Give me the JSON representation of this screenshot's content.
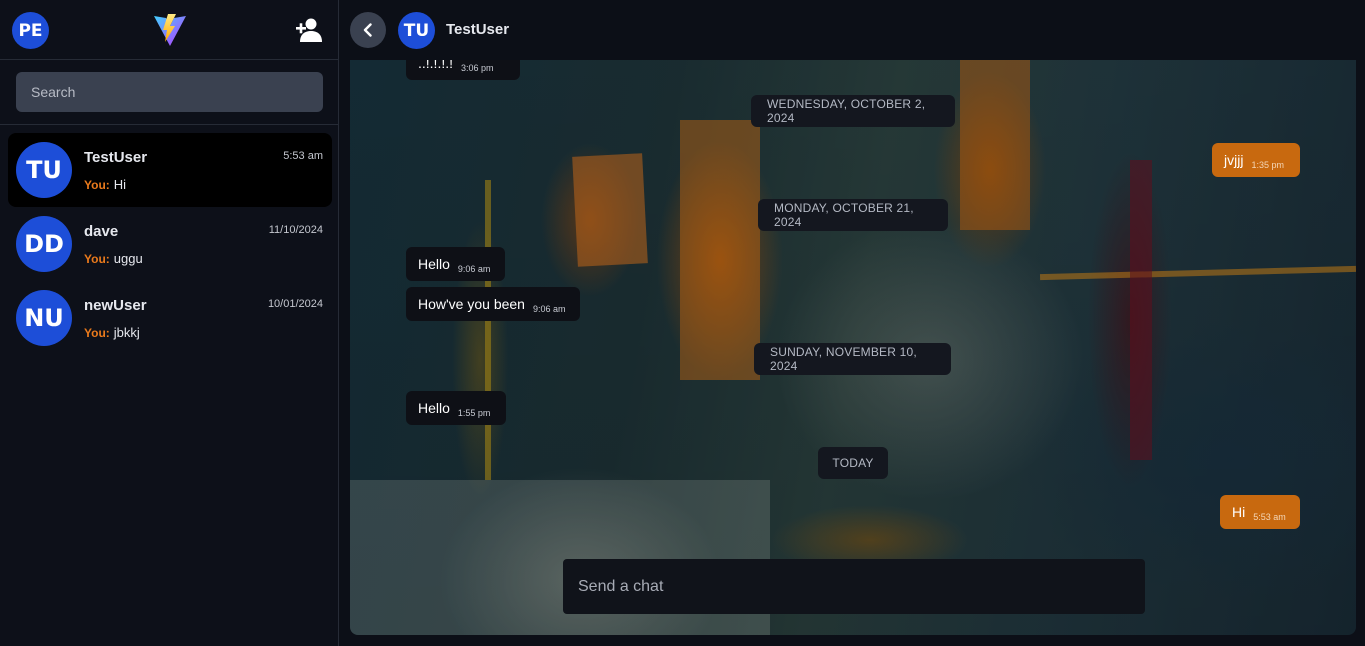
{
  "sidebar": {
    "user_initials": "PE",
    "search": {
      "placeholder": "Search",
      "value": ""
    },
    "conversations": [
      {
        "initials": "TU",
        "name": "TestUser",
        "time": "5:53 am",
        "you_label": "You:",
        "preview": "Hi",
        "active": true
      },
      {
        "initials": "DD",
        "name": "dave",
        "time": "11/10/2024",
        "you_label": "You:",
        "preview": "uggu",
        "active": false
      },
      {
        "initials": "NU",
        "name": "newUser",
        "time": "10/01/2024",
        "you_label": "You:",
        "preview": "jbkkj",
        "active": false
      }
    ]
  },
  "chat": {
    "header": {
      "initials": "TU",
      "name": "TestUser"
    },
    "partial_message": {
      "text": "..!.!.!.!",
      "time": "3:06 pm"
    },
    "dividers": [
      "WEDNESDAY, OCTOBER 2, 2024",
      "MONDAY, OCTOBER 21, 2024",
      "SUNDAY, NOVEMBER 10, 2024",
      "TODAY"
    ],
    "messages": [
      {
        "direction": "out",
        "text": "jvjjj",
        "time": "1:35 pm"
      },
      {
        "direction": "in",
        "text": "Hello",
        "time": "9:06 am"
      },
      {
        "direction": "in",
        "text": "How've you been",
        "time": "9:06 am"
      },
      {
        "direction": "in",
        "text": "Hello",
        "time": "1:55 pm"
      },
      {
        "direction": "out",
        "text": "Hi",
        "time": "5:53 am"
      }
    ],
    "composer": {
      "placeholder": "Send a chat",
      "value": ""
    }
  },
  "icons": {
    "logo": "vite-lightning-logo",
    "add_user": "add-user-icon",
    "back": "chevron-left-icon"
  },
  "colors": {
    "avatar_blue": "#1d4ed8",
    "outgoing_bubble": "#c8690f",
    "you_label": "#ea7a1c"
  }
}
